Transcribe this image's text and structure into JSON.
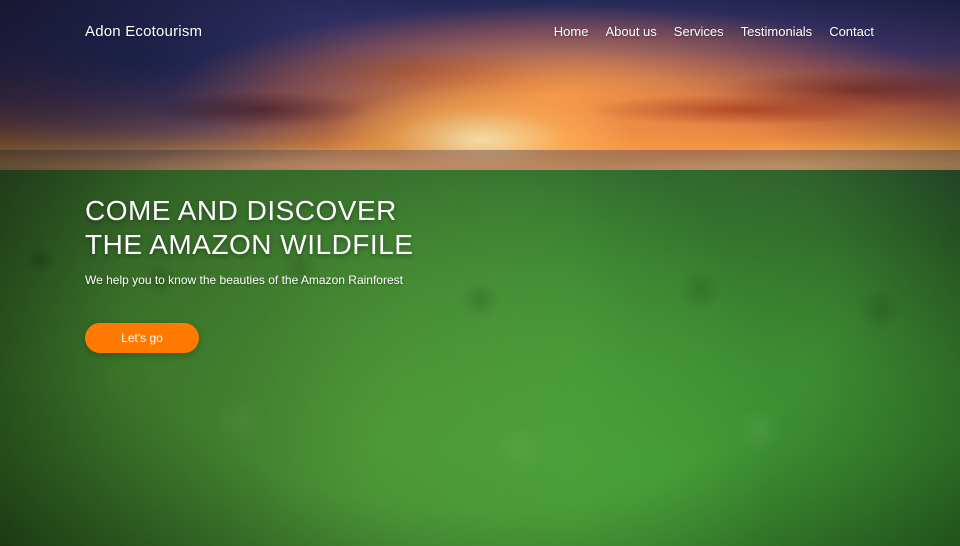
{
  "header": {
    "brand": "Adon Ecotourism",
    "nav": {
      "home": "Home",
      "about": "About us",
      "services": "Services",
      "testimonials": "Testimonials",
      "contact": "Contact"
    }
  },
  "hero": {
    "headline_line1": "COME AND DISCOVER",
    "headline_line2": "THE AMAZON WILDFILE",
    "subtitle": "We help you to know the beauties of the Amazon Rainforest",
    "cta_label": "Let's go"
  },
  "colors": {
    "cta": "#ff7a00",
    "text": "#ffffff"
  }
}
